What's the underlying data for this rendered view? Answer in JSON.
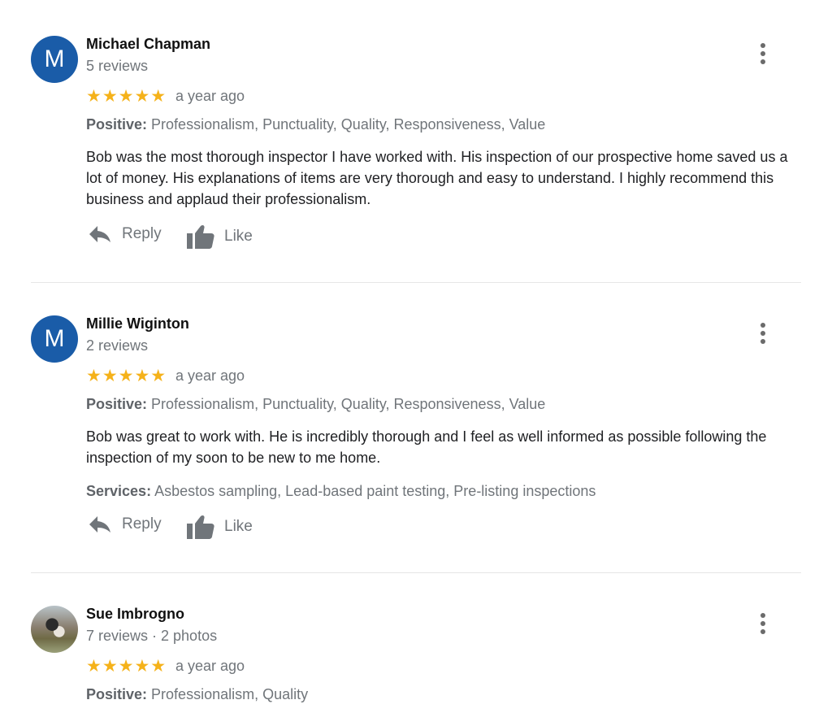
{
  "reviews": [
    {
      "avatar_letter": "M",
      "name": "Michael Chapman",
      "meta": "5 reviews",
      "stars": "★★★★★",
      "time": "a year ago",
      "positive_label": "Positive:",
      "positive_value": "Professionalism, Punctuality, Quality, Responsiveness, Value",
      "text": "Bob was the most thorough inspector I have worked with.  His inspection of our prospective home saved us a lot of money.  His explanations of items are very thorough and easy to understand.  I highly recommend this business and applaud their professionalism.",
      "reply_label": "Reply",
      "like_label": "Like"
    },
    {
      "avatar_letter": "M",
      "name": "Millie Wiginton",
      "meta": "2 reviews",
      "stars": "★★★★★",
      "time": "a year ago",
      "positive_label": "Positive:",
      "positive_value": "Professionalism, Punctuality, Quality, Responsiveness, Value",
      "text": "Bob was great to work with. He is incredibly thorough and I feel as well informed as possible following the inspection of my soon to be new to me home.",
      "services_label": "Services:",
      "services_value": "Asbestos sampling, Lead-based paint testing, Pre-listing inspections",
      "reply_label": "Reply",
      "like_label": "Like"
    },
    {
      "name": "Sue Imbrogno",
      "meta": "7 reviews · 2 photos",
      "stars": "★★★★★",
      "time": "a year ago",
      "positive_label": "Positive:",
      "positive_value": "Professionalism, Quality"
    }
  ],
  "colors": {
    "star": "#f5b21a",
    "avatar": "#1a5ca8",
    "muted": "#70757a"
  },
  "icons": {
    "menu": "more-vert-icon",
    "reply": "reply-arrow-icon",
    "like": "thumbs-up-icon"
  }
}
